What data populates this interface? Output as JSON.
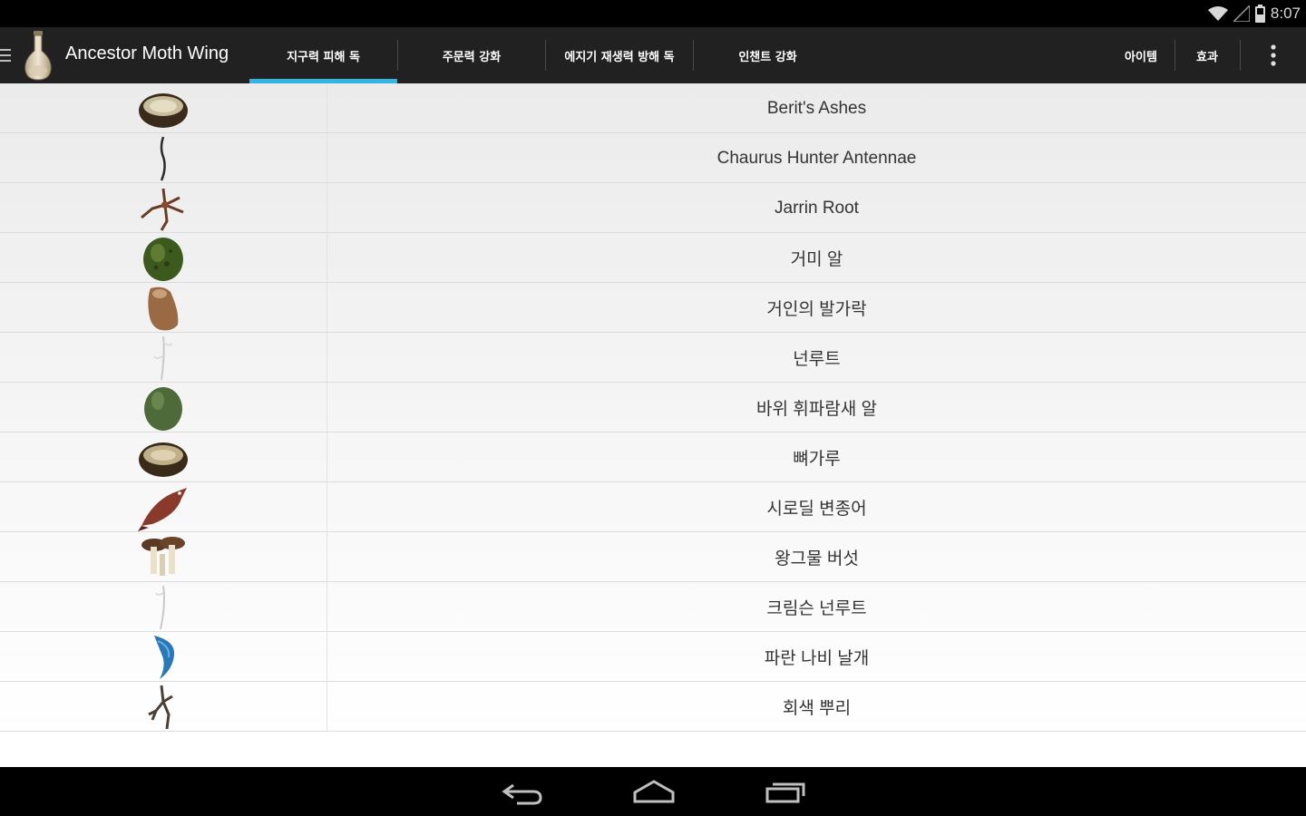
{
  "status_bar": {
    "time": "8:07",
    "icons": [
      "wifi-icon",
      "signal-icon",
      "battery-icon"
    ]
  },
  "action_bar": {
    "title": "Ancestor Moth Wing",
    "tabs": [
      {
        "label": "지구력 피해 독",
        "selected": true
      },
      {
        "label": "주문력 강화",
        "selected": false
      },
      {
        "label": "에지기 재생력 방해 독",
        "selected": false
      },
      {
        "label": "인챈트 강화",
        "selected": false
      }
    ],
    "actions": [
      "아이템",
      "효과"
    ],
    "accent_color": "#33b5e5"
  },
  "ingredients": [
    {
      "name": "Berit's Ashes",
      "icon": "bowl-of-ash-icon"
    },
    {
      "name": "Chaurus Hunter Antennae",
      "icon": "antennae-icon"
    },
    {
      "name": "Jarrin Root",
      "icon": "root-icon"
    },
    {
      "name": "거미 알",
      "icon": "spider-egg-icon"
    },
    {
      "name": "거인의 발가락",
      "icon": "giant-toe-icon"
    },
    {
      "name": "넌루트",
      "icon": "nirnroot-icon"
    },
    {
      "name": "바위 휘파람새 알",
      "icon": "rock-warbler-egg-icon"
    },
    {
      "name": "뼈가루",
      "icon": "bone-meal-bowl-icon"
    },
    {
      "name": "시로딜 변종어",
      "icon": "fish-icon"
    },
    {
      "name": "왕그물 버섯",
      "icon": "mushroom-icon"
    },
    {
      "name": "크림슨 넌루트",
      "icon": "crimson-nirnroot-icon"
    },
    {
      "name": "파란 나비 날개",
      "icon": "blue-butterfly-wing-icon"
    },
    {
      "name": "회색 뿌리",
      "icon": "grey-root-icon"
    }
  ]
}
